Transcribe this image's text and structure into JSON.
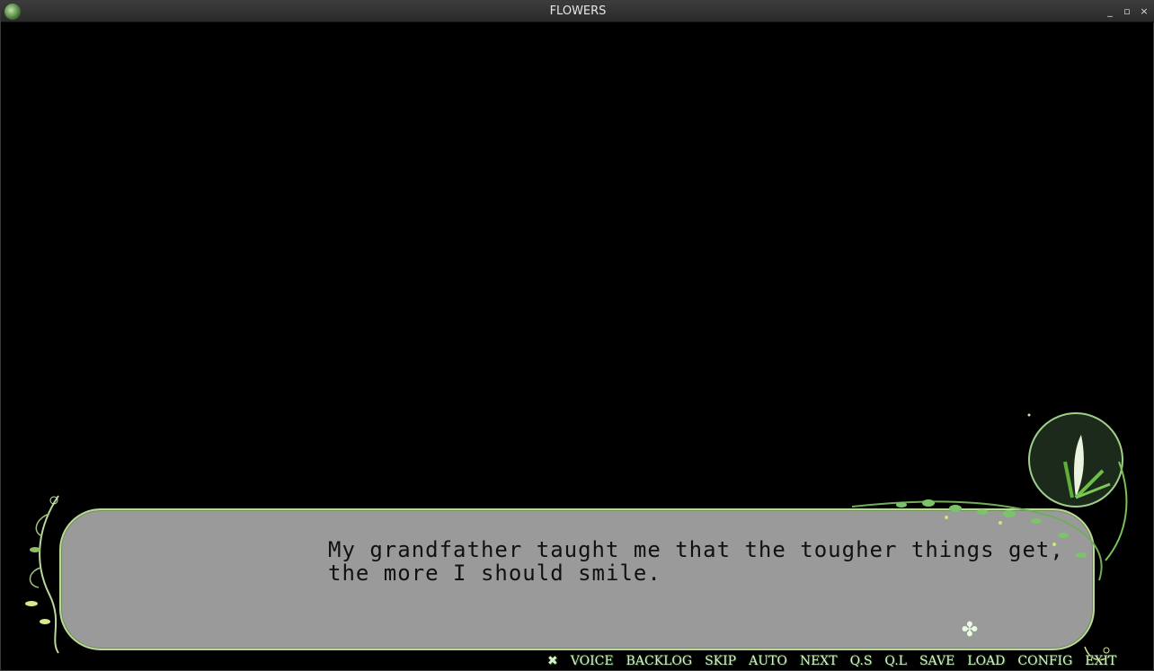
{
  "window": {
    "title": "FLOWERS"
  },
  "window_controls": {
    "minimize": "_",
    "maximize": "▫",
    "close": "×"
  },
  "dialogue": {
    "line1": "My grandfather taught me that the tougher things get,",
    "line2": "the more I should smile."
  },
  "menu": {
    "close": "✖",
    "voice": "VOICE",
    "backlog": "BACKLOG",
    "skip": "SKIP",
    "auto": "AUTO",
    "next": "NEXT",
    "qs": "Q.S",
    "ql": "Q.L",
    "save": "SAVE",
    "load": "LOAD",
    "config": "CONFIG",
    "exit": "EXIT"
  },
  "indicator": {
    "clover": "✤"
  },
  "colors": {
    "textbox_bg": "#9a9a9a",
    "accent_green": "#b9d89a",
    "menu_text": "#d8f0c8"
  }
}
